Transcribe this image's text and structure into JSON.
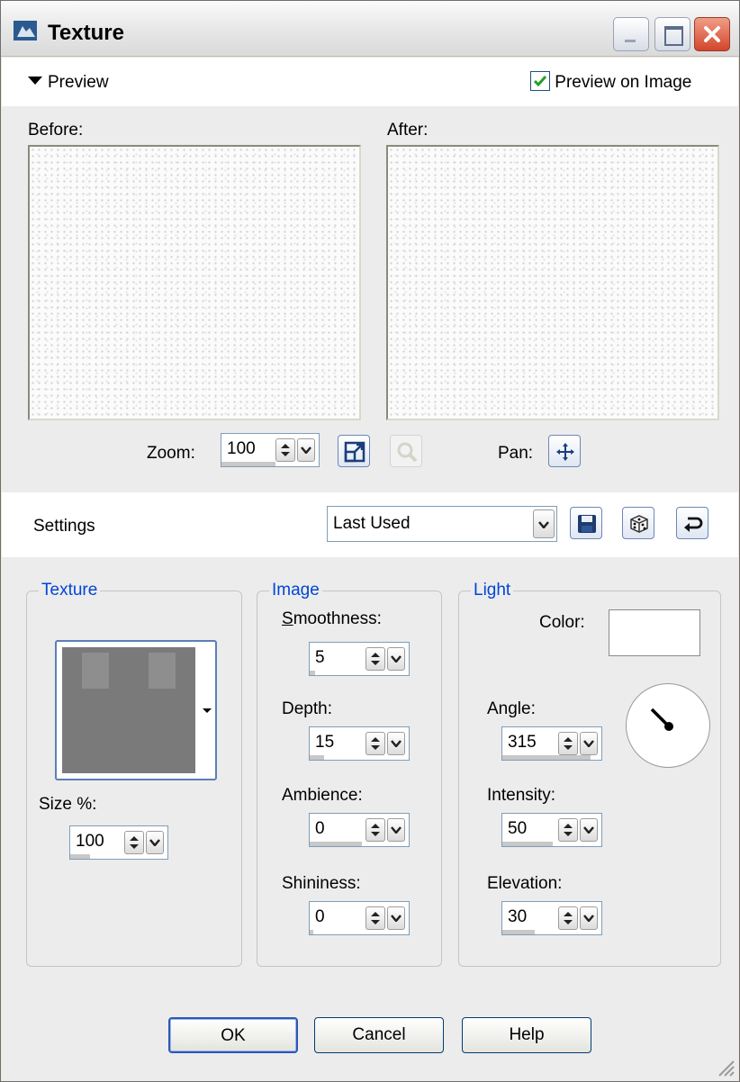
{
  "window": {
    "title": "Texture"
  },
  "preview": {
    "toggle_label": "Preview",
    "preview_on_image_label": "Preview on Image",
    "preview_on_image_checked": true,
    "before_label": "Before:",
    "after_label": "After:",
    "zoom_label": "Zoom:",
    "zoom_value": "100",
    "pan_label": "Pan:"
  },
  "settings": {
    "label": "Settings",
    "selected": "Last Used"
  },
  "texture_group": {
    "title": "Texture",
    "size_label": "Size %:",
    "size_value": "100"
  },
  "image_group": {
    "title": "Image",
    "smoothness_label": "Smoothness:",
    "smoothness_value": "5",
    "depth_label": "Depth:",
    "depth_value": "15",
    "ambience_label": "Ambience:",
    "ambience_value": "0",
    "shininess_label": "Shininess:",
    "shininess_value": "0"
  },
  "light_group": {
    "title": "Light",
    "color_label": "Color:",
    "color_value": "#ffffff",
    "angle_label": "Angle:",
    "angle_value": "315",
    "intensity_label": "Intensity:",
    "intensity_value": "50",
    "elevation_label": "Elevation:",
    "elevation_value": "30"
  },
  "buttons": {
    "ok": "OK",
    "cancel": "Cancel",
    "help": "Help"
  },
  "colors": {
    "group_title": "#0046d5",
    "window_bg": "#ececec"
  }
}
